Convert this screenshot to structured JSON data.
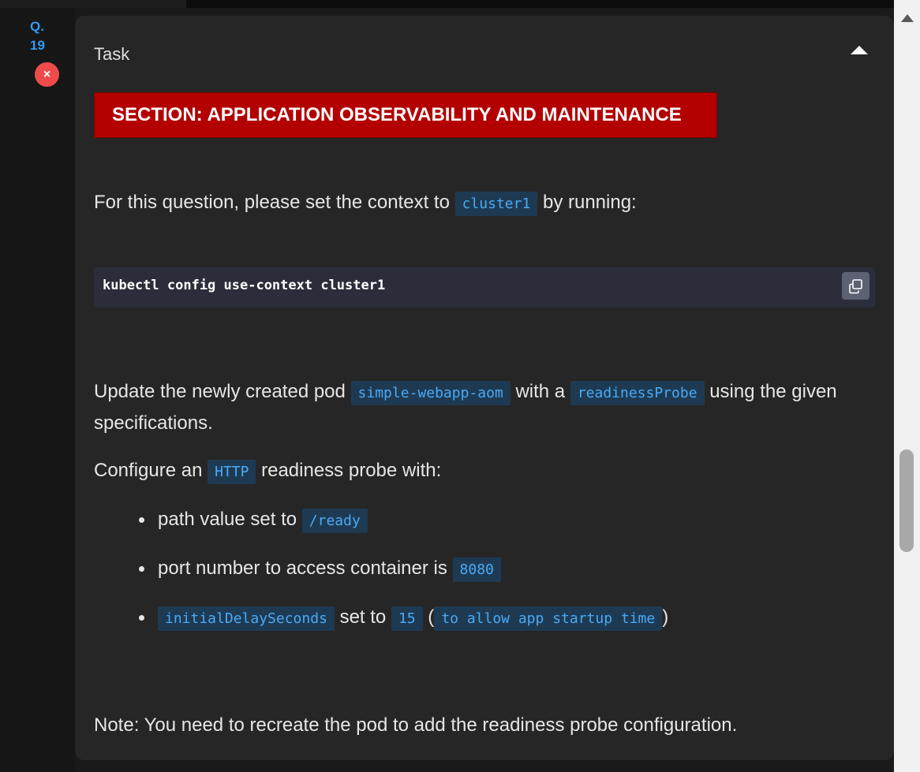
{
  "question": {
    "prefix": "Q.",
    "number": "19",
    "status_icon": "×"
  },
  "card": {
    "title": "Task"
  },
  "banner": {
    "text": "SECTION: APPLICATION OBSERVABILITY AND MAINTENANCE"
  },
  "context": {
    "before": "For this question, please set the context to ",
    "code": "cluster1",
    "after": " by running:"
  },
  "command": {
    "text": "kubectl config use-context cluster1",
    "copy_icon": "copy-icon"
  },
  "update": {
    "part1": "Update the newly created pod ",
    "pod_code": "simple-webapp-aom",
    "part2": " with a ",
    "probe_code": "readinessProbe",
    "part3": " using the given specifications."
  },
  "configure": {
    "before": "Configure an ",
    "code": "HTTP",
    "after": " readiness probe with:"
  },
  "specs": [
    {
      "text": "path value set to ",
      "code": "/ready"
    },
    {
      "text": "port number to access container is ",
      "code": "8080"
    },
    {
      "code1": "initialDelaySeconds",
      "text": " set to ",
      "code2": "15",
      "paren_open": " (",
      "code3": "to allow app startup time",
      "paren_close": ")"
    }
  ],
  "note": {
    "text": "Note: You need to recreate the pod to add the readiness probe configuration."
  },
  "colors": {
    "banner_bg": "#b30000",
    "code_fg": "#4aaaf5",
    "code_bg": "#1e3a53",
    "question_blue": "#2f9bf2",
    "status_red": "#ef4b4b"
  }
}
